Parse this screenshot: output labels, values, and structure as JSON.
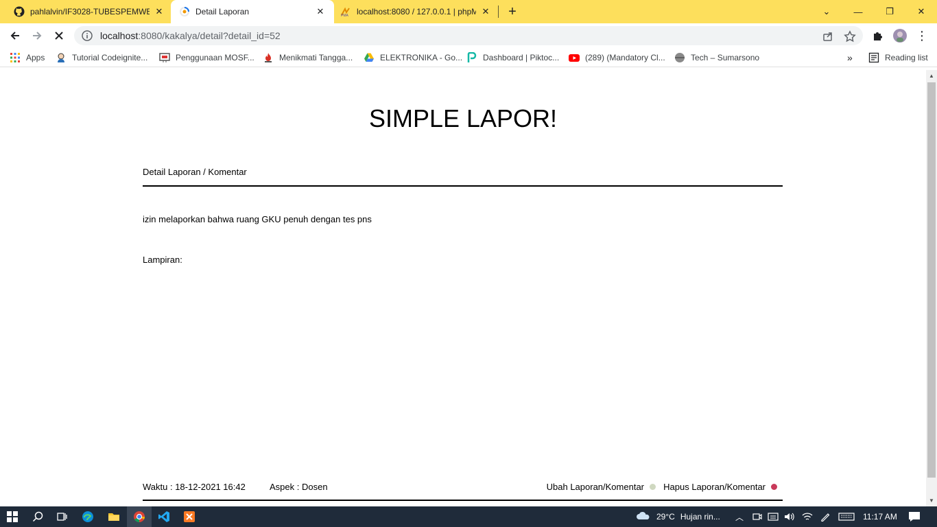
{
  "browser": {
    "tabs": [
      {
        "title": "pahlalvin/IF3028-TUBESPEMWEB",
        "icon": "github-icon"
      },
      {
        "title": "Detail Laporan",
        "icon": "loading-favicon",
        "active": true
      },
      {
        "title": "localhost:8080 / 127.0.0.1 | phpM",
        "icon": "phpmyadmin-icon"
      }
    ],
    "url_host": "localhost",
    "url_rest": ":8080/kakalya/detail?detail_id=52",
    "bookmarks": [
      {
        "label": "Apps",
        "icon": "apps-grid-icon"
      },
      {
        "label": "Tutorial Codeignite...",
        "icon": "avatar-icon"
      },
      {
        "label": "Penggunaan MOSF...",
        "icon": "slides-icon"
      },
      {
        "label": "Menikmati Tangga...",
        "icon": "flame-icon"
      },
      {
        "label": "ELEKTRONIKA - Go...",
        "icon": "google-drive-icon"
      },
      {
        "label": "Dashboard | Piktoc...",
        "icon": "piktochart-icon"
      },
      {
        "label": "(289) (Mandatory Cl...",
        "icon": "youtube-icon"
      },
      {
        "label": "Tech – Sumarsono",
        "icon": "globe-icon"
      }
    ],
    "reading_list": "Reading list"
  },
  "page": {
    "title": "SIMPLE LAPOR!",
    "section_heading": "Detail Laporan / Komentar",
    "report_text": "izin melaporkan bahwa ruang GKU penuh dengan tes pns",
    "attachment_label": "Lampiran:",
    "waktu": "Waktu : 18-12-2021 16:42",
    "aspek": "Aspek : Dosen",
    "edit_link": "Ubah Laporan/Komentar",
    "delete_link": "Hapus Laporan/Komentar"
  },
  "taskbar": {
    "weather_temp": "29°C",
    "weather_desc": "Hujan rin...",
    "time": "11:17 AM"
  },
  "colors": {
    "tabstrip": "#fddf5c",
    "edit_dot": "#cfd8c0",
    "delete_dot": "#c93a5a"
  }
}
